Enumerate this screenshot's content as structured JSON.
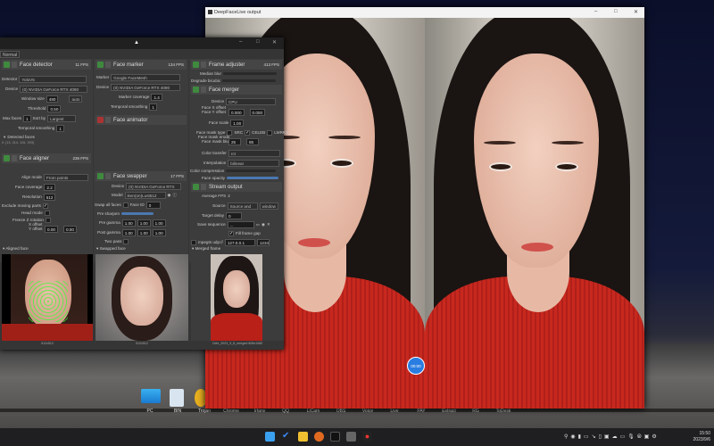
{
  "output_window": {
    "title": "DeepFaceLive output"
  },
  "timer": {
    "label": "00:00"
  },
  "dfl": {
    "mode_tab": "Normal",
    "face_detector": {
      "title": "Face detector",
      "fps": "11 FPS",
      "detector_label": "Detector",
      "detector": "YoloV5",
      "device_label": "Device",
      "device": "(0) NVIDIA GeForce RTX 4090",
      "window_size_label": "Window size",
      "window_size": "480",
      "auto": "auto",
      "threshold_label": "Threshold",
      "threshold": "0.50",
      "max_faces_label": "Max faces",
      "max_faces": "1",
      "sort_by_label": "Sort by",
      "sort_by": "Largest",
      "temporal_label": "Temporal smoothing",
      "temporal": "1",
      "detected_label": "Detected faces",
      "detected_value": "0: [13, 314, 126, 393]"
    },
    "face_aligner": {
      "title": "Face aligner",
      "fps": "236 FPS",
      "align_mode_label": "Align mode",
      "align_mode": "From points",
      "coverage_label": "Face coverage",
      "coverage": "2.2",
      "resolution_label": "Resolution",
      "resolution": "512",
      "exclude_label": "Exclude moving parts",
      "head_mode_label": "Head mode",
      "freeze_label": "Freeze Z rotation",
      "x_offset_label": "X offset",
      "y_offset_label": "Y offset",
      "x_offset": "0.00",
      "y_offset": "0.00"
    },
    "face_marker": {
      "title": "Face marker",
      "fps": "134 FPS",
      "marker_label": "Marker",
      "marker": "Google FaceMesh",
      "device_label": "Device",
      "device": "(0) NVIDIA GeForce RTX 4090",
      "coverage_label": "Marker coverage",
      "coverage": "1.4",
      "temporal_label": "Temporal smoothing",
      "temporal": "1"
    },
    "face_animator": {
      "title": "Face animator"
    },
    "face_swapper": {
      "title": "Face swapper",
      "fps": "17 FPS",
      "device_label": "Device",
      "device": "(0) NVIDIA GeForce RTX",
      "model_label": "Model",
      "model": "iken(on)Lust512",
      "swap_all_label": "Swap all faces",
      "face_id_label": "Face ID",
      "face_id": "0",
      "pre_sharpen_label": "Pre sharpen",
      "pre_gamma_label": "Pre gamma",
      "post_gamma_label": "Post gamma",
      "gamma": [
        "1.00",
        "1.00",
        "1.00"
      ],
      "two_pass_label": "Two pass"
    },
    "frame_adjuster": {
      "title": "Frame adjuster",
      "fps": "413 FPS",
      "median_label": "Median blur",
      "degrade_label": "Degrade bicubic"
    },
    "face_merger": {
      "title": "Face merger",
      "device_label": "Device",
      "device": "CPU",
      "x_offset_label": "Face X offset",
      "y_offset_label": "Face Y offset",
      "x_offset": "0.000",
      "y_offset": "0.000",
      "scale_label": "Face scale",
      "scale": "1.00",
      "mask_type_label": "Face mask type",
      "mask_src": "SRC",
      "mask_celeb": "CELEB",
      "mask_lmrks": "LMRKS",
      "erode_label": "Face mask erode",
      "blur_label": "Face mask blur",
      "erode": "25",
      "blur": "85",
      "color_transfer_label": "Color transfer",
      "color_transfer": "rct",
      "interp_label": "Interpolation",
      "interp": "bilinear",
      "compression_label": "Color compression",
      "opacity_label": "Face opacity"
    },
    "stream_output": {
      "title": "Stream output",
      "avg_fps_label": "Average FPS",
      "avg_fps": "2",
      "source_label": "Source",
      "source": "Source and",
      "window": "window",
      "delay_label": "Target delay",
      "delay": "0",
      "save_label": "Save sequence",
      "save_path": "...",
      "fill_gap_label": "Fill frame gap",
      "mpegts_label": "mpegts udp://",
      "address": "127.0.0.1",
      "port": "1234"
    },
    "previews": {
      "aligned": "Aligned face",
      "swapped": "Swapped face",
      "merged": "Merged frame",
      "aligned_caption": "512x512",
      "swapped_caption": "512x512",
      "merged_caption": "Ochi_2023_9_6_merged 808x1080"
    }
  },
  "desktop": {
    "icons": [
      "PC",
      "BIN",
      "Trojan",
      "Chrome",
      "Irfanv",
      "QQ",
      "LiCam",
      "OBS",
      "Voice",
      "Live",
      "PAY",
      "Extract",
      "RG",
      "ToDesk"
    ]
  },
  "clock": {
    "time": "15:50",
    "date": "2023/9/6"
  }
}
